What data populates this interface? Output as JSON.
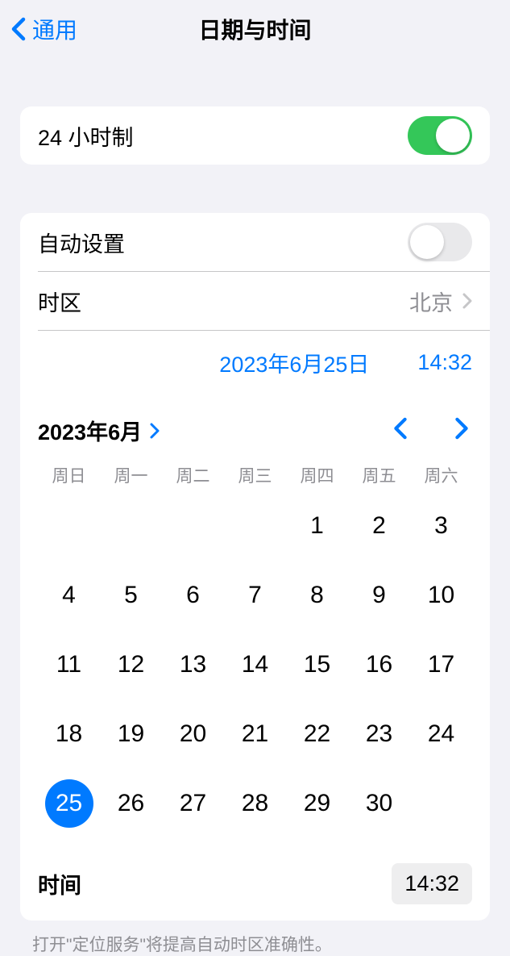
{
  "header": {
    "back_label": "通用",
    "title": "日期与时间"
  },
  "settings": {
    "twentyfour_hour_label": "24 小时制",
    "twentyfour_hour_on": true,
    "auto_set_label": "自动设置",
    "auto_set_on": false,
    "timezone_label": "时区",
    "timezone_value": "北京"
  },
  "datetime": {
    "date_display": "2023年6月25日",
    "time_display": "14:32"
  },
  "calendar": {
    "month_label": "2023年6月",
    "weekdays": [
      "周日",
      "周一",
      "周二",
      "周三",
      "周四",
      "周五",
      "周六"
    ],
    "first_weekday": 4,
    "days_in_month": 30,
    "selected_day": 25
  },
  "time_row": {
    "label": "时间",
    "value": "14:32"
  },
  "footnote": "打开\"定位服务\"将提高自动时区准确性。"
}
